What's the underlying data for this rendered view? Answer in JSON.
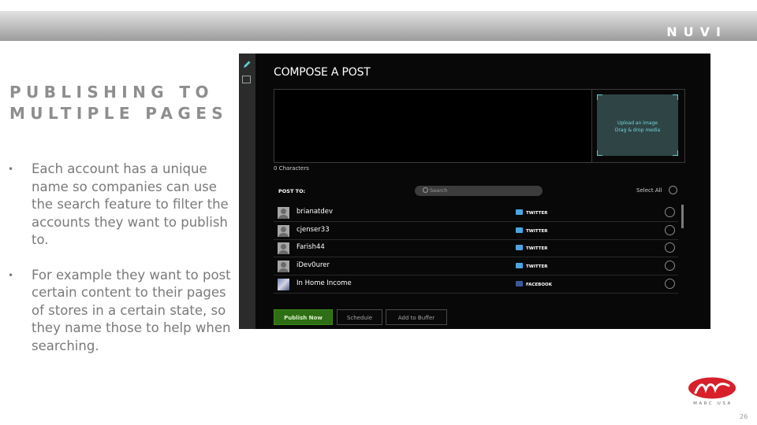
{
  "header": {
    "brand": "NUVI"
  },
  "slide": {
    "title": "PUBLISHING TO MULTIPLE PAGES",
    "bullets": [
      "Each account has a unique name so companies can use the search feature to filter the accounts they want to publish to.",
      "For example they want to post certain content to their pages of stores in a certain state, so they name those to help when searching."
    ],
    "bullet_glyph": "•",
    "page_number": "26",
    "footer_logo_text": "MARC USA"
  },
  "compose": {
    "title": "COMPOSE A POST",
    "upload_line1": "Upload an image",
    "upload_line2": "Drag & drop media",
    "char_count": "0 Characters",
    "post_to_label": "POST TO:",
    "search_placeholder": "Search",
    "select_all_label": "Select All",
    "accounts": [
      {
        "name": "brianatdev",
        "network": "TWITTER"
      },
      {
        "name": "cjenser33",
        "network": "TWITTER"
      },
      {
        "name": "Farish44",
        "network": "TWITTER"
      },
      {
        "name": "iDev0urer",
        "network": "TWITTER"
      },
      {
        "name": "In Home Income",
        "network": "FACEBOOK"
      }
    ],
    "buttons": {
      "publish": "Publish Now",
      "schedule": "Schedule",
      "buffer": "Add to Buffer"
    }
  },
  "colors": {
    "publish_green": "#2e6e14",
    "twitter_blue": "#4aa6e3",
    "facebook_blue": "#3b5998",
    "upload_accent": "#6fd7dd",
    "logo_red": "#d8202a"
  },
  "icons": {
    "sidebar": [
      "pencil-icon",
      "calendar-icon"
    ],
    "search": "search-icon",
    "avatar_placeholder": "user-silhouette-icon",
    "network_twitter": "twitter-icon",
    "network_facebook": "facebook-icon"
  }
}
